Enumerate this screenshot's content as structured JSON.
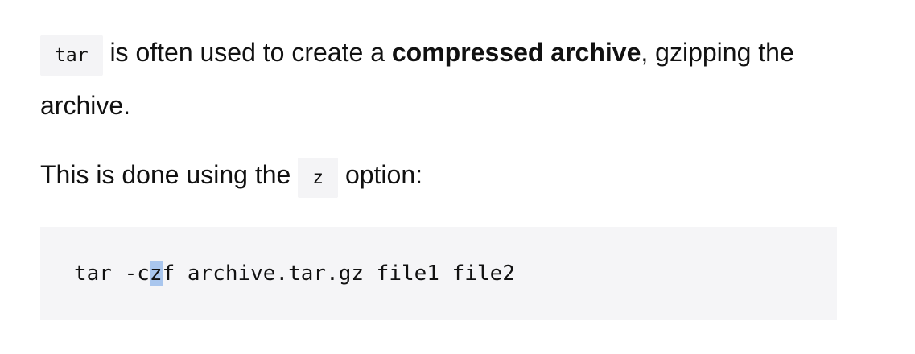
{
  "para1": {
    "code": "tar",
    "text1": " is often used to create a ",
    "bold": "compressed archive",
    "text2": ", gzipping the archive."
  },
  "para2": {
    "text1": "This is done using the ",
    "code": "z",
    "text2": " option:"
  },
  "codeblock": {
    "before": "tar -c",
    "selected": "z",
    "after": "f archive.tar.gz file1 file2"
  },
  "colors": {
    "code_bg": "#f5f5f7",
    "selection": "#a9c6ee"
  }
}
